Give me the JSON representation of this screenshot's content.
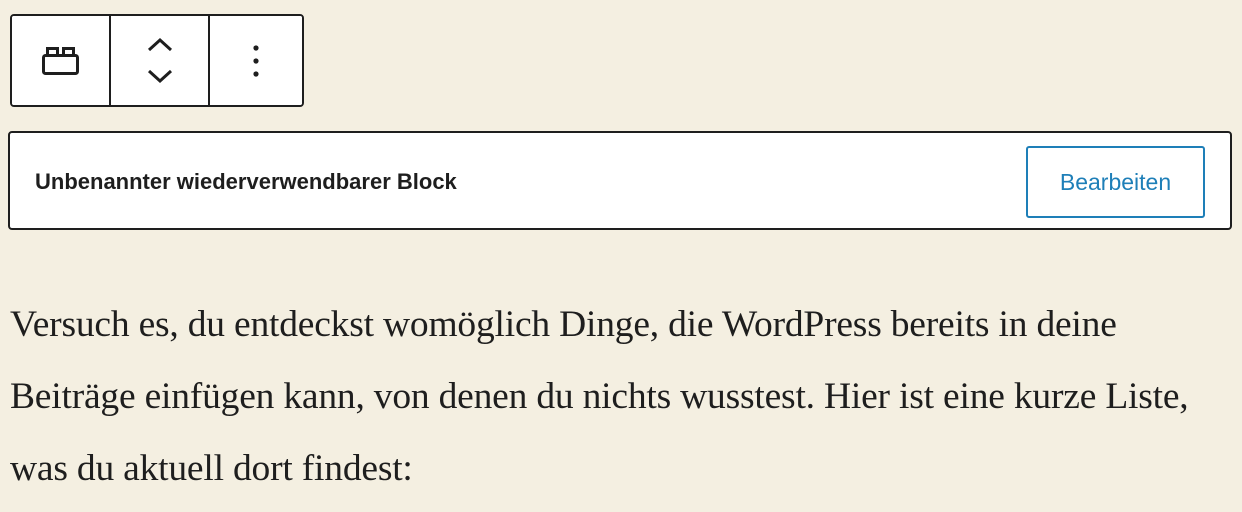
{
  "toolbar": {
    "items": [
      {
        "icon": "reusable-block-icon"
      },
      {
        "icon": "move-up-down-icon"
      },
      {
        "icon": "more-options-icon"
      }
    ]
  },
  "reusable_block": {
    "title": "Unbenannter wiederverwendbarer Block",
    "edit_label": "Bearbeiten"
  },
  "content": {
    "paragraph": "Versuch es, du entdeckst womöglich Dinge, die WordPress bereits in deine Beiträge einfügen kann, von denen du nichts wusstest. Hier ist eine kurze Liste, was du aktuell dort findest:"
  },
  "colors": {
    "background": "#f4efe1",
    "border": "#1e1e1e",
    "accent": "#1e7fb8"
  }
}
